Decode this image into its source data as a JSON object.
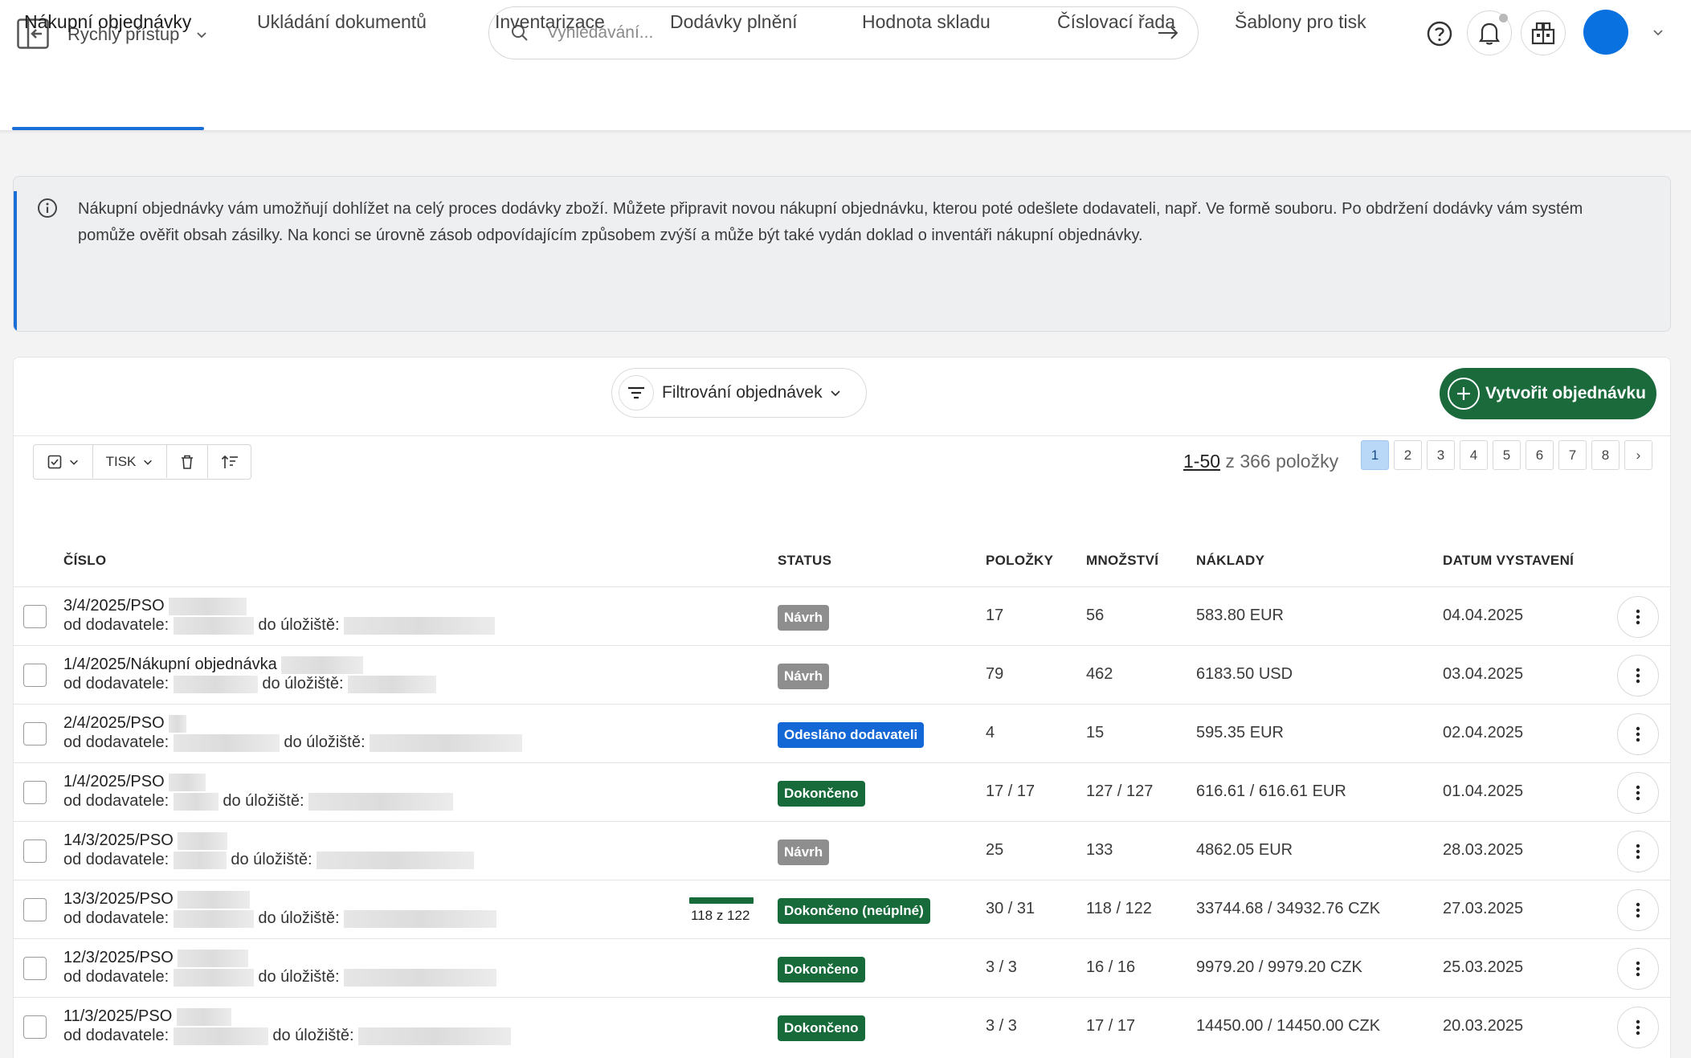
{
  "header": {
    "quick_access_label": "Rychlý přístup",
    "search_placeholder": "Vyhledávání..."
  },
  "tabs": [
    {
      "label": "Nákupní objednávky",
      "active": true
    },
    {
      "label": "Ukládání dokumentů"
    },
    {
      "label": "Inventarizace"
    },
    {
      "label": "Dodávky plnění"
    },
    {
      "label": "Hodnota skladu"
    },
    {
      "label": "Číslovací řada"
    },
    {
      "label": "Šablony pro tisk"
    }
  ],
  "info": {
    "text": "Nákupní objednávky vám umožňují dohlížet na celý proces dodávky zboží. Můžete připravit novou nákupní objednávku, kterou poté odešlete dodavateli, např. Ve formě souboru. Po obdržení dodávky vám systém pomůže ověřit obsah zásilky. Na konci se úrovně zásob odpovídajícím způsobem zvýší a může být také vydán doklad o inventáři nákupní objednávky."
  },
  "actions": {
    "filter_label": "Filtrování objednávek",
    "create_label": "Vytvořit objednávku",
    "print_label": "TISK"
  },
  "pagination": {
    "range": "1-50",
    "total_text": " z 366 položky",
    "pages": [
      "1",
      "2",
      "3",
      "4",
      "5",
      "6",
      "7",
      "8"
    ],
    "current_page": "1",
    "next_symbol": "›"
  },
  "table": {
    "columns": {
      "number": "ČÍSLO",
      "status": "STATUS",
      "items": "POLOŽKY",
      "quantity": "MNOŽSTVÍ",
      "costs": "NÁKLADY",
      "issue_date": "DATUM VYSTAVENÍ"
    },
    "supplier_prefix": "od dodavatele:",
    "storage_prefix": "do úložiště:",
    "rows": [
      {
        "number": "3/4/2025/PSO",
        "status": "Návrh",
        "status_type": "draft",
        "items": "17",
        "quantity": "56",
        "costs": "583.80 EUR",
        "date": "04.04.2025"
      },
      {
        "number": "1/4/2025/Nákupní objednávka",
        "status": "Návrh",
        "status_type": "draft",
        "items": "79",
        "quantity": "462",
        "costs": "6183.50 USD",
        "date": "03.04.2025"
      },
      {
        "number": "2/4/2025/PSO",
        "status": "Odesláno dodavateli",
        "status_type": "sent",
        "items": "4",
        "quantity": "15",
        "costs": "595.35 EUR",
        "date": "02.04.2025"
      },
      {
        "number": "1/4/2025/PSO",
        "status": "Dokončeno",
        "status_type": "done",
        "items": "17 / 17",
        "quantity": "127 / 127",
        "costs": "616.61 / 616.61 EUR",
        "date": "01.04.2025"
      },
      {
        "number": "14/3/2025/PSO",
        "status": "Návrh",
        "status_type": "draft",
        "items": "25",
        "quantity": "133",
        "costs": "4862.05 EUR",
        "date": "28.03.2025"
      },
      {
        "number": "13/3/2025/PSO",
        "status": "Dokončeno (neúplné)",
        "status_type": "done",
        "items": "30 / 31",
        "quantity": "118 / 122",
        "costs": "33744.68 / 34932.76 CZK",
        "date": "27.03.2025",
        "progress_label": "118 z 122",
        "progress": 0.967
      },
      {
        "number": "12/3/2025/PSO",
        "status": "Dokončeno",
        "status_type": "done",
        "items": "3 / 3",
        "quantity": "16 / 16",
        "costs": "9979.20 / 9979.20 CZK",
        "date": "25.03.2025"
      },
      {
        "number": "11/3/2025/PSO",
        "status": "Dokončeno",
        "status_type": "done",
        "items": "3 / 3",
        "quantity": "17 / 17",
        "costs": "14450.00 / 14450.00 CZK",
        "date": "20.03.2025"
      }
    ]
  },
  "colors": {
    "accent": "#1a6fd6",
    "create_button": "#1a6a3c",
    "status_done": "#176a3a",
    "status_sent": "#1468d6",
    "status_draft": "#8e8e8e"
  },
  "icons": [
    "sidebar-toggle-icon",
    "chevron-down-icon",
    "search-icon",
    "arrow-right-icon",
    "help-icon",
    "bell-icon",
    "apps-icon",
    "info-icon",
    "filter-icon",
    "plus-icon",
    "checkbox-select-icon",
    "trash-icon",
    "sort-icon",
    "more-vertical-icon"
  ]
}
